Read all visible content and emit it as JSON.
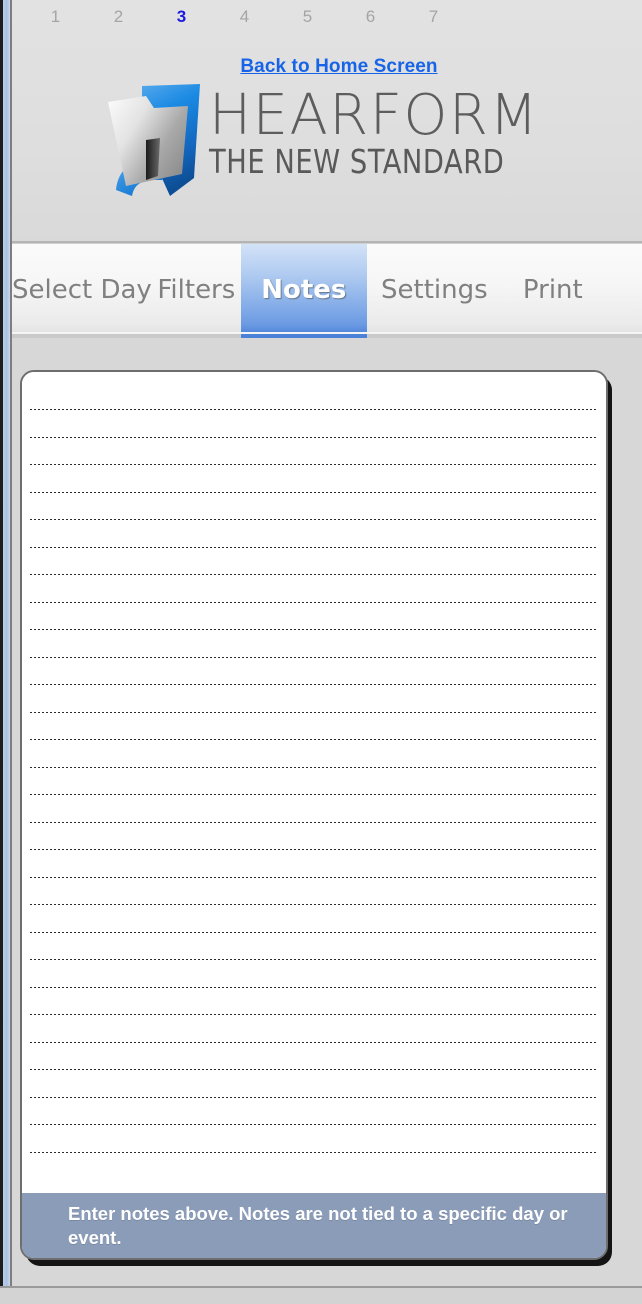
{
  "window": {
    "accent_blue": "#4a82d9",
    "background": "#d7d7d7"
  },
  "header": {
    "page_numbers": [
      {
        "label": "1",
        "active": false
      },
      {
        "label": "2",
        "active": false
      },
      {
        "label": "3",
        "active": true
      },
      {
        "label": "4",
        "active": false
      },
      {
        "label": "5",
        "active": false
      },
      {
        "label": "6",
        "active": false
      },
      {
        "label": "7",
        "active": false
      }
    ],
    "back_link": "Back to Home Screen",
    "logo": {
      "icon": "folder-icon",
      "title": "HEARFORM",
      "tagline": "THE NEW STANDARD"
    }
  },
  "tabs": [
    {
      "label": "Select Day",
      "active": false,
      "key": "select-day"
    },
    {
      "label": "Filters",
      "active": false,
      "key": "filters"
    },
    {
      "label": "Notes",
      "active": true,
      "key": "notes"
    },
    {
      "label": "Settings",
      "active": false,
      "key": "settings"
    },
    {
      "label": "Print",
      "active": false,
      "key": "print"
    }
  ],
  "notes": {
    "value": "",
    "placeholder": "",
    "line_count": 28,
    "status_message": "Enter notes above. Notes are not tied to a specific day or event."
  }
}
